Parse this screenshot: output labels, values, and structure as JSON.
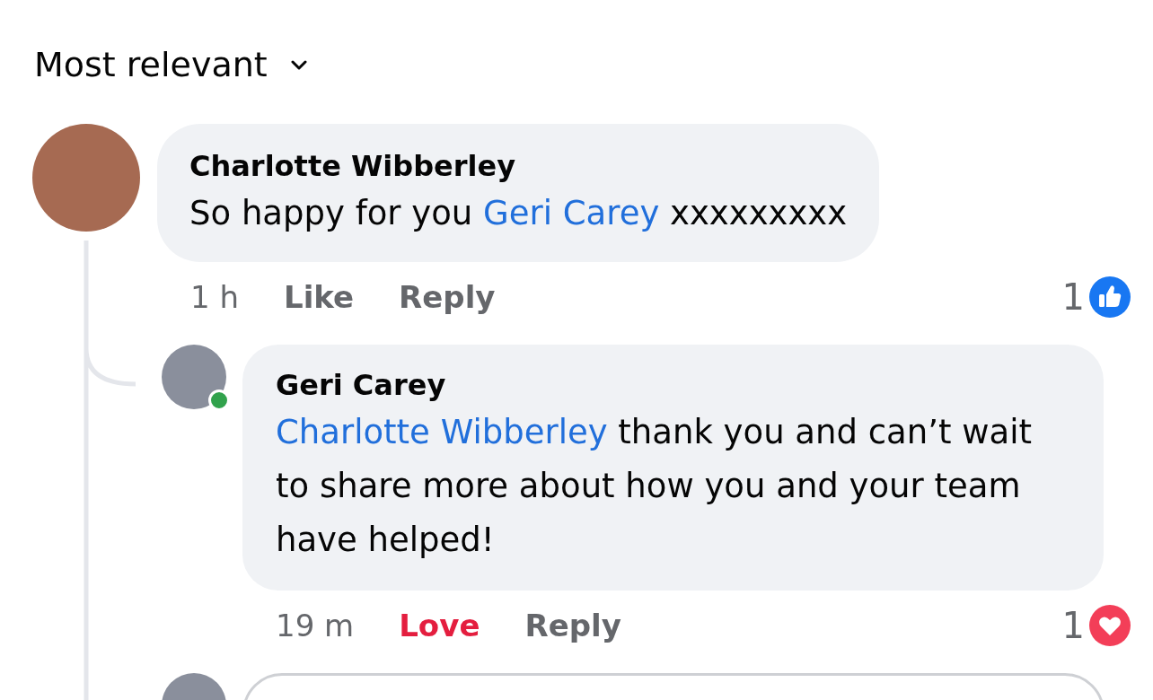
{
  "sort": {
    "label": "Most relevant"
  },
  "comments": [
    {
      "author": "Charlotte Wibberley",
      "online": false,
      "body": [
        {
          "kind": "text",
          "text": "So happy for you "
        },
        {
          "kind": "mention",
          "text": "Geri Carey"
        },
        {
          "kind": "text",
          "text": " xxxxxxxxx"
        }
      ],
      "time": "1 h",
      "reaction": {
        "label": "Like",
        "reacted": false
      },
      "reply_label": "Reply",
      "summary": {
        "count": "1",
        "kind": "like"
      },
      "replies": [
        {
          "author": "Geri Carey",
          "online": true,
          "body": [
            {
              "kind": "mention",
              "text": "Charlotte Wibberley"
            },
            {
              "kind": "text",
              "text": " thank you and can’t wait to share more about how you and your team  have helped!"
            }
          ],
          "time": "19 m",
          "reaction": {
            "label": "Love",
            "reacted": true
          },
          "reply_label": "Reply",
          "summary": {
            "count": "1",
            "kind": "love"
          }
        }
      ]
    }
  ]
}
